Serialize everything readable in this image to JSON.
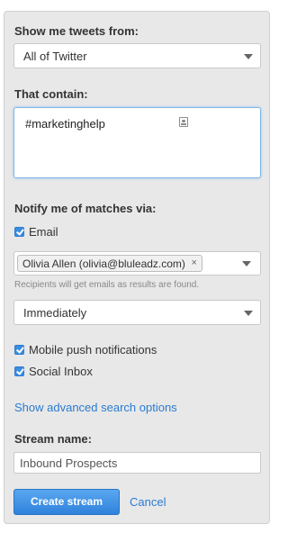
{
  "form": {
    "source_label": "Show me tweets from:",
    "source_value": "All of Twitter",
    "contain_label": "That contain:",
    "contain_value": "#marketinghelp",
    "notify_label": "Notify me of matches via:",
    "email_label": "Email",
    "email_checked": true,
    "recipient_token": "Olivia Allen (olivia@bluleadz.com)",
    "recipient_remove": "×",
    "recipients_hint": "Recipients will get emails as results are found.",
    "frequency_value": "Immediately",
    "mobile_push_label": "Mobile push notifications",
    "mobile_push_checked": true,
    "social_inbox_label": "Social Inbox",
    "social_inbox_checked": true,
    "advanced_link": "Show advanced search options",
    "stream_name_label": "Stream name:",
    "stream_name_value": "Inbound Prospects",
    "create_button": "Create stream",
    "cancel_link": "Cancel"
  },
  "icons": {
    "dropdown": "chevron-down-icon",
    "contact": "contact-card-icon",
    "checkbox": "checkmark-icon"
  },
  "colors": {
    "panel_bg": "#e8e8e8",
    "accent": "#2f82dc",
    "link": "#2a7bd1",
    "checkbox": "#3b8ee0",
    "focus_border": "#7fb4e6"
  }
}
